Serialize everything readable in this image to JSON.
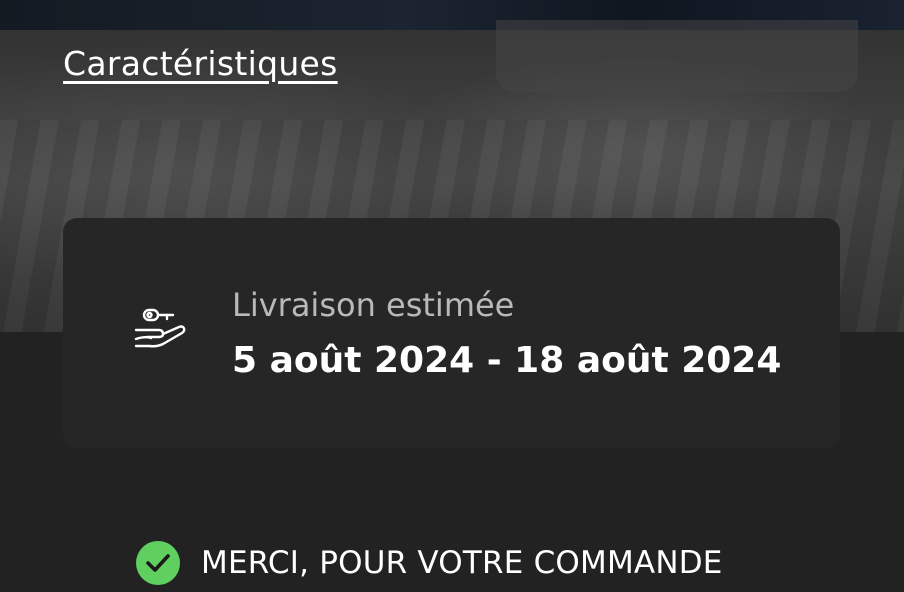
{
  "specs": {
    "link_label": "Caractéristiques"
  },
  "delivery": {
    "label": "Livraison estimée",
    "dates": "5 août 2024 - 18 août 2024",
    "icon": "hand-key-icon"
  },
  "confirmation": {
    "message": "MERCI, POUR VOTRE COMMANDE",
    "icon": "check-circle-icon",
    "icon_color": "#5fcf5f"
  }
}
